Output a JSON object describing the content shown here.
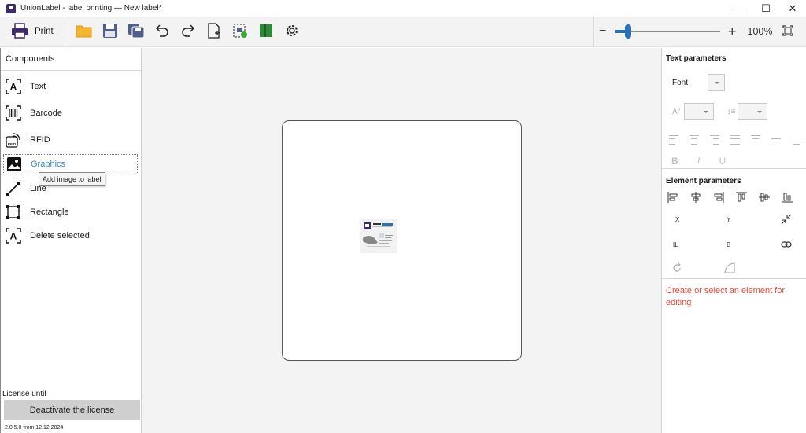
{
  "window": {
    "title": "UnionLabel - label printing — New label*",
    "minimize": "—",
    "maximize": "☐",
    "close": "✕"
  },
  "toolbar": {
    "print_label": "Print",
    "icons": [
      "open-folder-icon",
      "save-icon",
      "save-all-icon",
      "undo-icon",
      "redo-icon",
      "new-label-icon",
      "label-settings-icon",
      "book-icon",
      "settings-gear-icon"
    ],
    "zoom": {
      "minus": "−",
      "plus": "+",
      "value": "100%",
      "level": 0.1
    }
  },
  "components": {
    "header": "Components",
    "items": [
      {
        "label": "Text",
        "icon": "text-icon"
      },
      {
        "label": "Barcode",
        "icon": "barcode-icon"
      },
      {
        "label": "RFID",
        "icon": "rfid-icon"
      },
      {
        "label": "Graphics",
        "icon": "image-icon",
        "active": true
      },
      {
        "label": "Line",
        "icon": "line-icon"
      },
      {
        "label": "Rectangle",
        "icon": "rectangle-icon"
      },
      {
        "label": "Delete selected",
        "icon": "delete-selected-icon"
      }
    ],
    "tooltip": "Add image to label"
  },
  "license": {
    "until_label": "License until",
    "deactivate_button": "Deactivate the license",
    "version": "2.0.5.0 from 12.12.2024"
  },
  "text_parameters": {
    "title": "Text parameters",
    "font_label": "Font",
    "size_glyph": "A°",
    "spacing_glyph": "↕≡",
    "bold": "B",
    "italic": "I",
    "underline": "U"
  },
  "element_parameters": {
    "title": "Element parameters",
    "x_label": "X",
    "y_label": "Y",
    "width_label": "Ш",
    "height_label": "В"
  },
  "hint_text": "Create or select an element for editing",
  "colors": {
    "accent": "#2b6fb5",
    "active_text": "#3a88c8",
    "hint": "#e8483b",
    "brand": "#3e2a66"
  }
}
